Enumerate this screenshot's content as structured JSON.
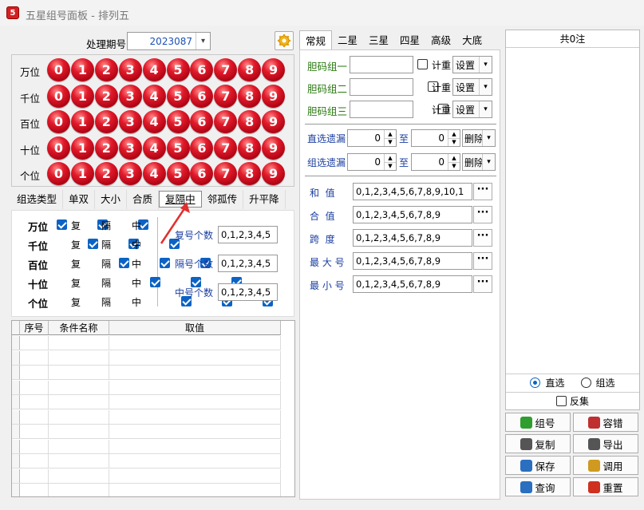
{
  "window": {
    "title": "五星组号面板 - 排列五",
    "icon_text": "5"
  },
  "period": {
    "label": "处理期号",
    "value": "2023087"
  },
  "digits": [
    "0",
    "1",
    "2",
    "3",
    "4",
    "5",
    "6",
    "7",
    "8",
    "9"
  ],
  "positions": [
    "万位",
    "千位",
    "百位",
    "十位",
    "个位"
  ],
  "left_tabs": [
    "组选类型",
    "单双",
    "大小",
    "合质",
    "复隔中",
    "邻孤传",
    "升平降"
  ],
  "left_tab_active": 4,
  "check_labels": {
    "fu": "复",
    "ge": "隔",
    "zhong": "中"
  },
  "counts": [
    {
      "label": "复号个数",
      "value": "0,1,2,3,4,5"
    },
    {
      "label": "隔号个数",
      "value": "0,1,2,3,4,5"
    },
    {
      "label": "中号个数",
      "value": "0,1,2,3,4,5"
    }
  ],
  "table": {
    "headers": [
      "序号",
      "条件名称",
      "取值"
    ],
    "row_count": 11
  },
  "mid_tabs": [
    "常规",
    "二星",
    "三星",
    "四星",
    "高级",
    "大底"
  ],
  "mid_tab_active": 0,
  "dan_groups": [
    {
      "label": "胆码组一",
      "check": "计重",
      "select": "设置"
    },
    {
      "label": "胆码组二",
      "check": "计重",
      "select": "设置"
    },
    {
      "label": "胆码组三",
      "check": "计重",
      "select": "设置"
    }
  ],
  "omissions": [
    {
      "label": "直选遗漏",
      "from": "0",
      "to_label": "至",
      "to": "0",
      "action": "删除"
    },
    {
      "label": "组选遗漏",
      "from": "0",
      "to_label": "至",
      "to": "0",
      "action": "删除"
    }
  ],
  "filters": [
    {
      "label": "和  值",
      "value": "0,1,2,3,4,5,6,7,8,9,10,1"
    },
    {
      "label": "合  值",
      "value": "0,1,2,3,4,5,6,7,8,9"
    },
    {
      "label": "跨  度",
      "value": "0,1,2,3,4,5,6,7,8,9"
    },
    {
      "label": "最 大 号",
      "value": "0,1,2,3,4,5,6,7,8,9"
    },
    {
      "label": "最 小 号",
      "value": "0,1,2,3,4,5,6,7,8,9"
    }
  ],
  "dots_label": "···",
  "result": {
    "header": "共0注",
    "radio_direct": "直选",
    "radio_group": "组选",
    "invert": "反集"
  },
  "buttons": [
    {
      "label": "组号",
      "color": "#2e9e2e"
    },
    {
      "label": "容错",
      "color": "#c03030"
    },
    {
      "label": "复制",
      "color": "#555555"
    },
    {
      "label": "导出",
      "color": "#555555"
    },
    {
      "label": "保存",
      "color": "#2a6fc0"
    },
    {
      "label": "调用",
      "color": "#d09a20"
    },
    {
      "label": "查询",
      "color": "#2a6fc0"
    },
    {
      "label": "重置",
      "color": "#d03020"
    }
  ],
  "accent": "#0b63c4",
  "ball_color": "#e01a2a"
}
